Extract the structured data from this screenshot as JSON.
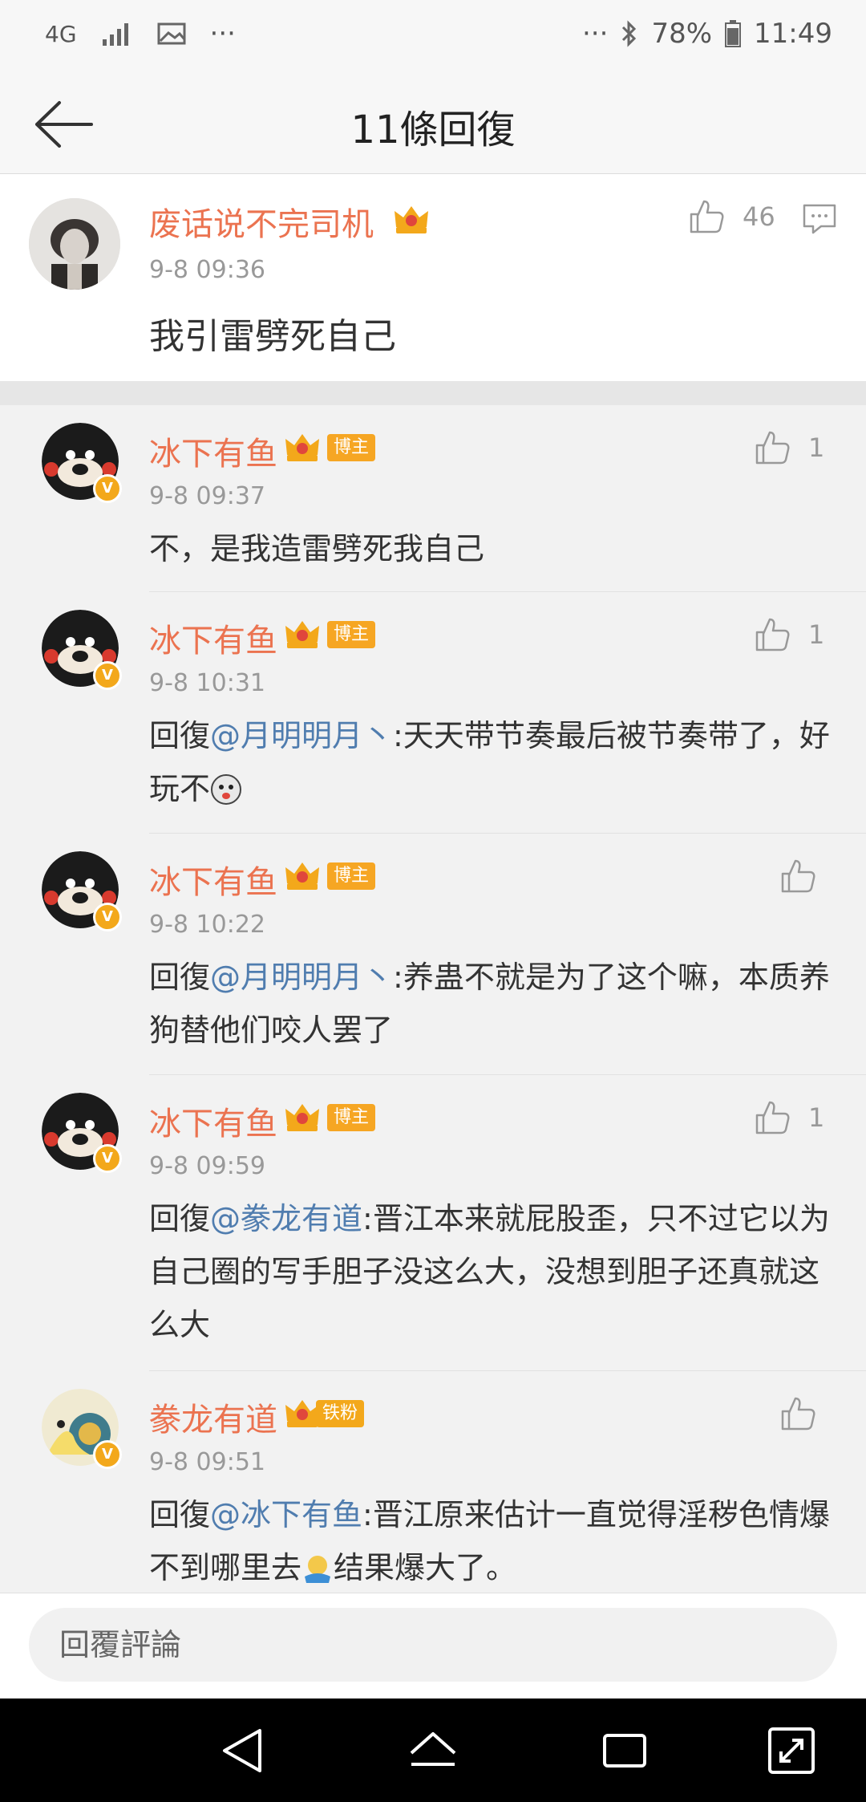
{
  "status_bar": {
    "network": "4G",
    "more_left": "···",
    "more_right": "···",
    "battery": "78%",
    "time": "11:49"
  },
  "header": {
    "title": "11條回復"
  },
  "top_comment": {
    "author": "废话说不完司机",
    "time": "9-8 09:36",
    "likes": "46",
    "text": "我引雷劈死自己"
  },
  "replies": [
    {
      "author": "冰下有鱼",
      "tag": "博主",
      "time": "9-8 09:37",
      "likes": "1",
      "prefix": "",
      "mention": "",
      "text": "不，是我造雷劈死我自己"
    },
    {
      "author": "冰下有鱼",
      "tag": "博主",
      "time": "9-8 10:31",
      "likes": "1",
      "prefix": "回復",
      "mention": "@月明明月丶",
      "text": ":天天带节奏最后被节奏带了，好玩不"
    },
    {
      "author": "冰下有鱼",
      "tag": "博主",
      "time": "9-8 10:22",
      "likes": "",
      "prefix": "回復",
      "mention": "@月明明月丶",
      "text": ":养蛊不就是为了这个嘛，本质养狗替他们咬人罢了"
    },
    {
      "author": "冰下有鱼",
      "tag": "博主",
      "time": "9-8 09:59",
      "likes": "1",
      "prefix": "回復",
      "mention": "@豢龙有道",
      "text": ":晋江本来就屁股歪，只不过它以为自己圈的写手胆子没这么大，没想到胆子还真就这么大"
    },
    {
      "author": "豢龙有道",
      "tag": "铁粉",
      "time": "9-8 09:51",
      "likes": "",
      "prefix": "回復",
      "mention": "@冰下有鱼",
      "text": ":晋江原来估计一直觉得淫秽色情爆不到哪里去",
      "text2": "结果爆大了。"
    }
  ],
  "input": {
    "placeholder": "回覆評論"
  },
  "colors": {
    "name": "#eb7350",
    "mention": "#507daf",
    "tag": "#f6a623",
    "crown": "#f3a81b"
  },
  "icons": {
    "back": "back-arrow-icon",
    "like": "thumbs-up-icon",
    "comment": "comment-icon",
    "crown": "vip-crown-icon",
    "verified": "verified-v-icon"
  }
}
